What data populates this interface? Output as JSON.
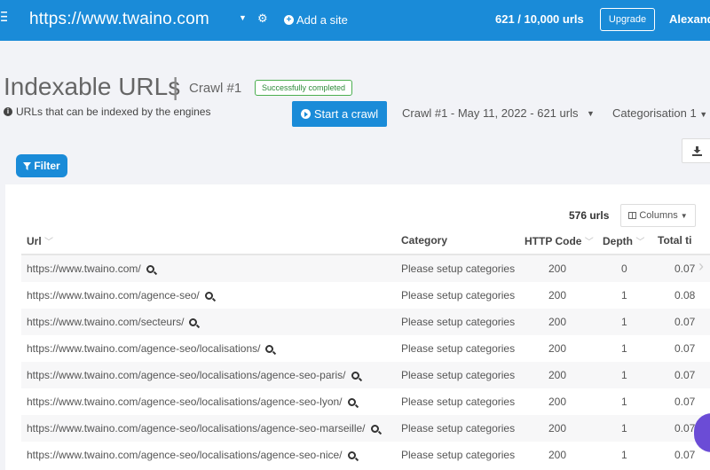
{
  "topbar": {
    "menu_icon": "menu-icon",
    "site": "https://www.twaino.com",
    "add_site": "Add a site",
    "quota": "621 / 10,000 urls",
    "upgrade": "Upgrade",
    "user": "Alexand"
  },
  "header": {
    "title": "Indexable URLs",
    "separator": "|",
    "crawl": "Crawl #1",
    "status": "Successfully completed",
    "subtitle": "URLs that can be indexed by the engines",
    "start_crawl": "Start a crawl",
    "crawl_select": "Crawl #1 - May 11, 2022 - 621 urls",
    "categorisation": "Categorisation 1"
  },
  "toolbar": {
    "filter": "Filter",
    "url_count": "576 urls",
    "columns": "Columns"
  },
  "table": {
    "headers": {
      "url": "Url",
      "category": "Category",
      "http_code": "HTTP Code",
      "depth": "Depth",
      "total_time": "Total ti"
    },
    "rows": [
      {
        "url": "https://www.twaino.com/",
        "category": "Please setup categories",
        "code": "200",
        "depth": "0",
        "time": "0.07"
      },
      {
        "url": "https://www.twaino.com/agence-seo/",
        "category": "Please setup categories",
        "code": "200",
        "depth": "1",
        "time": "0.08"
      },
      {
        "url": "https://www.twaino.com/secteurs/",
        "category": "Please setup categories",
        "code": "200",
        "depth": "1",
        "time": "0.07"
      },
      {
        "url": "https://www.twaino.com/agence-seo/localisations/",
        "category": "Please setup categories",
        "code": "200",
        "depth": "1",
        "time": "0.07"
      },
      {
        "url": "https://www.twaino.com/agence-seo/localisations/agence-seo-paris/",
        "category": "Please setup categories",
        "code": "200",
        "depth": "1",
        "time": "0.07"
      },
      {
        "url": "https://www.twaino.com/agence-seo/localisations/agence-seo-lyon/",
        "category": "Please setup categories",
        "code": "200",
        "depth": "1",
        "time": "0.07"
      },
      {
        "url": "https://www.twaino.com/agence-seo/localisations/agence-seo-marseille/",
        "category": "Please setup categories",
        "code": "200",
        "depth": "1",
        "time": "0.07"
      },
      {
        "url": "https://www.twaino.com/agence-seo/localisations/agence-seo-nice/",
        "category": "Please setup categories",
        "code": "200",
        "depth": "1",
        "time": "0.07"
      }
    ]
  },
  "colors": {
    "brand": "#1a8bd8",
    "success": "#4caf50",
    "chat": "#6b4cd6"
  }
}
